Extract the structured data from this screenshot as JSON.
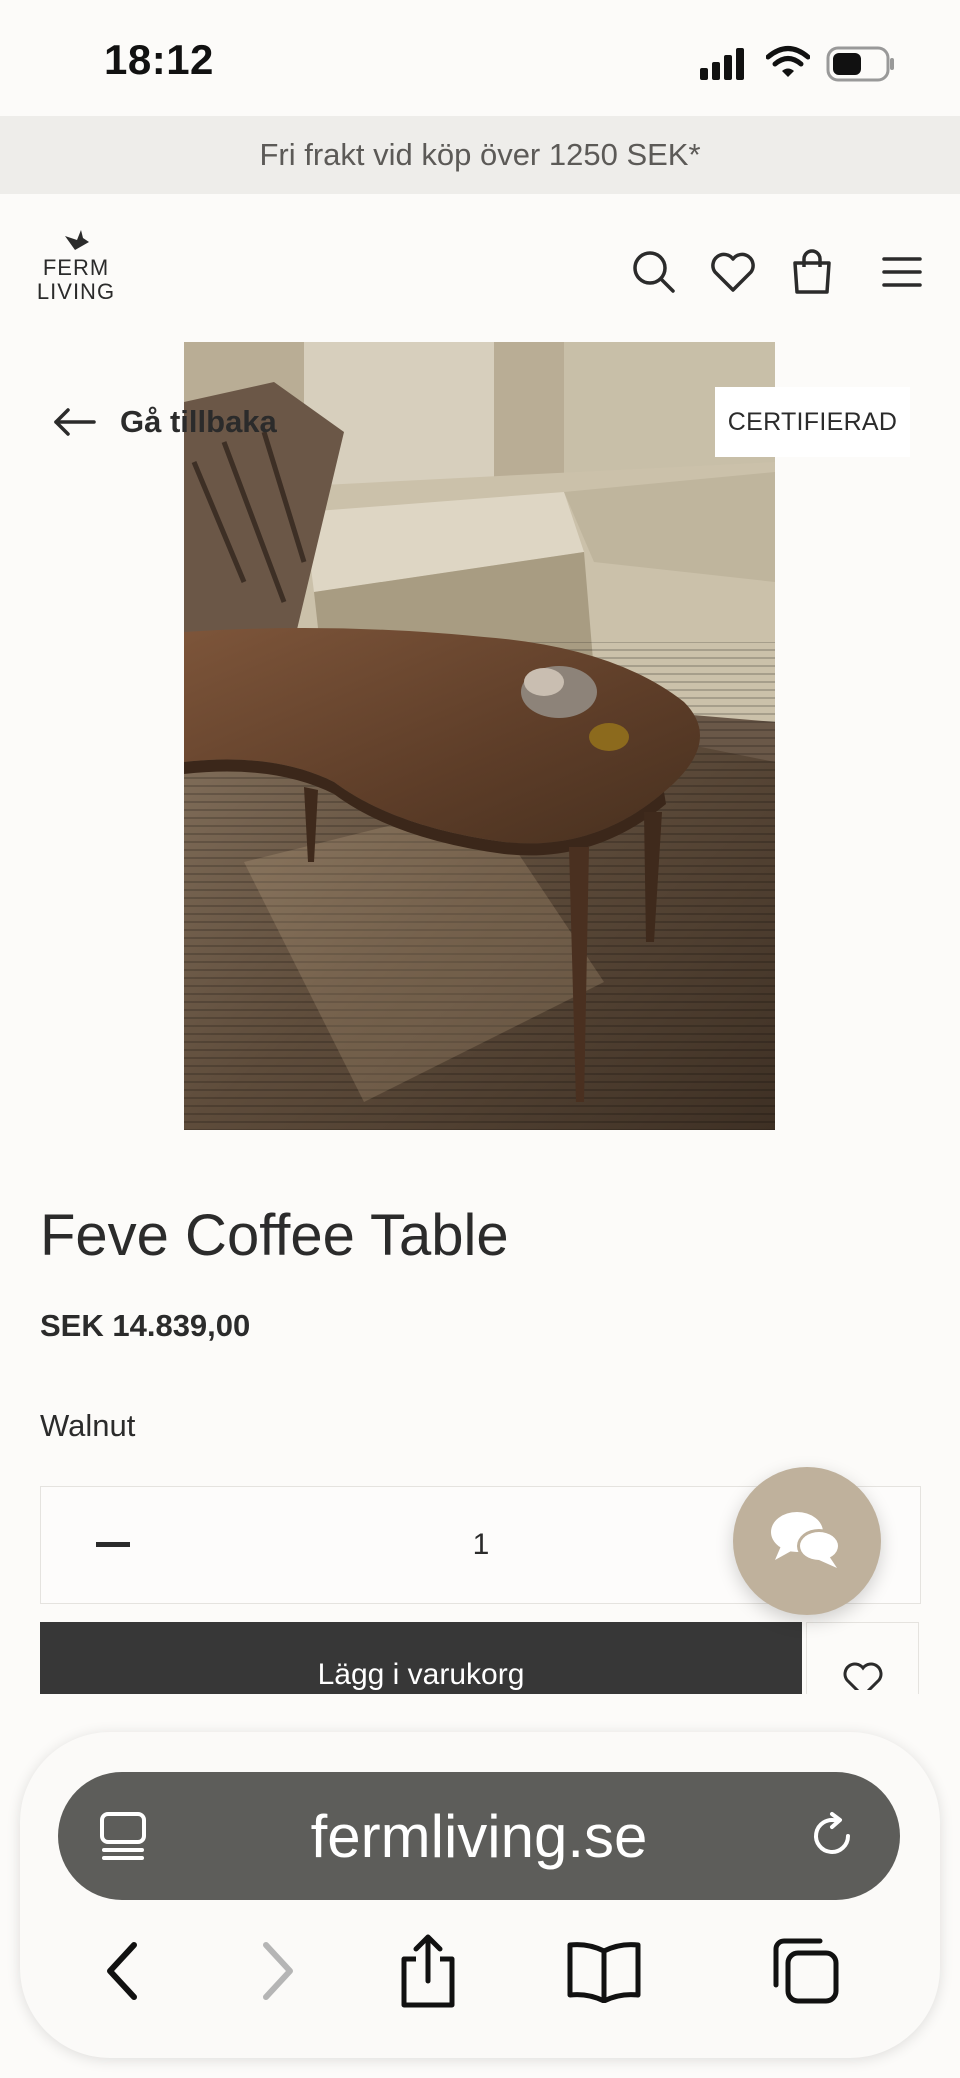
{
  "status_bar": {
    "time": "18:12",
    "icons": [
      "signal-icon",
      "wifi-icon",
      "battery-icon"
    ]
  },
  "promo_banner": {
    "text": "Fri frakt vid köp över 1250 SEK*"
  },
  "header": {
    "logo": {
      "line1": "FERM",
      "line2": "LIVING"
    },
    "icons": [
      "search-icon",
      "heart-icon",
      "bag-icon",
      "menu-icon"
    ]
  },
  "product": {
    "back_label": "Gå tillbaka",
    "badge": "CERTIFIERAD",
    "title": "Feve Coffee Table",
    "price": "SEK 14.839,00",
    "variant": "Walnut",
    "quantity": "1",
    "add_to_cart": "Lägg i varukorg"
  },
  "colors": {
    "background": "#fcfbf9",
    "banner_bg": "#eeedea",
    "dark_button": "#373737",
    "chat_fab": "#bfb19c",
    "url_bar": "#5d5d5a"
  },
  "browser": {
    "url": "fermliving.se",
    "icons": [
      "tab-list-icon",
      "reload-icon",
      "back-icon",
      "forward-icon",
      "share-icon",
      "bookmarks-icon",
      "tabs-icon"
    ]
  }
}
